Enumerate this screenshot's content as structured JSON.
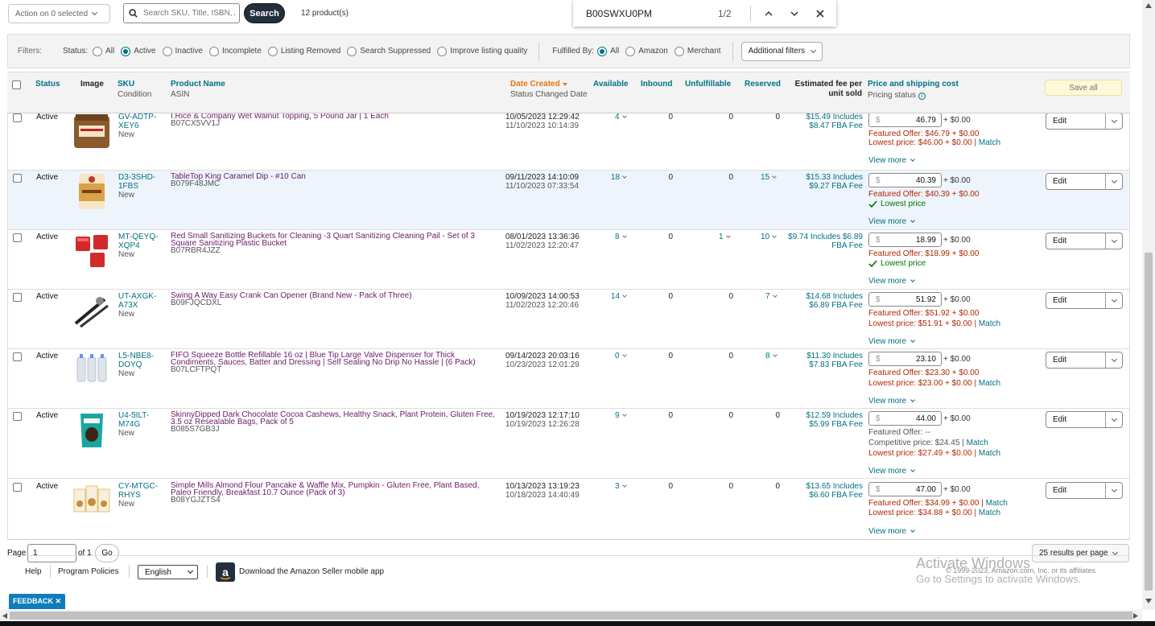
{
  "toolbar": {
    "action_label": "Action on 0 selected",
    "search_placeholder": "Search SKU, Title, ISBN, ASIN",
    "search_button": "Search",
    "product_count": "12 product(s)"
  },
  "findbar": {
    "query": "B00SWXU0PM",
    "count": "1/2"
  },
  "filters": {
    "label": "Filters:",
    "status_label": "Status:",
    "status_options": [
      "All",
      "Active",
      "Inactive",
      "Incomplete",
      "Listing Removed",
      "Search Suppressed",
      "Improve listing quality"
    ],
    "status_selected": "Active",
    "fulfilled_label": "Fulfilled By:",
    "fulfilled_options": [
      "All",
      "Amazon",
      "Merchant"
    ],
    "fulfilled_selected": "All",
    "additional_filters": "Additional filters"
  },
  "table": {
    "headers": {
      "status": "Status",
      "image": "Image",
      "sku": "SKU",
      "condition": "Condition",
      "product_name": "Product Name",
      "asin": "ASIN",
      "date_created": "Date Created",
      "status_changed": "Status Changed Date",
      "available": "Available",
      "inbound": "Inbound",
      "unfulfillable": "Unfulfillable",
      "reserved": "Reserved",
      "estimated_fee": "Estimated fee per unit sold",
      "price_shipping": "Price and shipping cost",
      "pricing_status": "Pricing status"
    },
    "save_all": "Save all",
    "view_more": "View more",
    "edit_label": "Edit",
    "currency_symbol": "$",
    "rows": [
      {
        "status": "Active",
        "sku": "GV-ADTP-XEY6",
        "condition": "New",
        "name": "I.Rice & Company Wet Walnut Topping, 5 Pound Jar | 1 Each",
        "asin": "B07CX5VV1J",
        "created": "10/05/2023 12:29:42",
        "changed": "11/10/2023 10:14:39",
        "available": "4",
        "inbound": "0",
        "unfulfillable": "0",
        "reserved": "0",
        "fee": "$15.49 Includes $8.47 FBA Fee",
        "price": "46.79",
        "ship": "+ $0.00",
        "line1": "Featured Offer: $46.79 + $0.00",
        "line2": "Lowest price: $46.00 + $0.00 | ",
        "line2_match": "Match",
        "thumb_color": "#8a5a2b",
        "highlight": false
      },
      {
        "status": "Active",
        "sku": "D3-3SHD-1FBS",
        "condition": "New",
        "name": "TableTop King Caramel Dip - #10 Can",
        "asin": "B079F48JMC",
        "created": "09/11/2023 14:10:09",
        "changed": "11/10/2023 07:33:54",
        "available": "18",
        "inbound": "0",
        "unfulfillable": "0",
        "reserved": "15",
        "fee": "$15.33 Includes $9.27 FBA Fee",
        "price": "40.39",
        "ship": "+ $0.00",
        "line1": "Featured Offer: $40.39 + $0.00",
        "line2": "Lowest price",
        "line2_match": "",
        "thumb_color": "#d9a24a",
        "highlight": true
      },
      {
        "status": "Active",
        "sku": "MT-QEYQ-XQP4",
        "condition": "New",
        "name": "Red Small Sanitizing Buckets for Cleaning -3 Quart Sanitizing Cleaning Pail - Set of 3 Square Sanitizing Plastic Bucket",
        "asin": "B07RBR4JZZ",
        "created": "08/01/2023 13:36:36",
        "changed": "11/02/2023 12:20:47",
        "available": "8",
        "inbound": "0",
        "unfulfillable": "1",
        "reserved": "10",
        "fee": "$9.74 Includes $6.89 FBA Fee",
        "price": "18.99",
        "ship": "+ $0.00",
        "line1": "Featured Offer: $18.99 + $0.00",
        "line2": "Lowest price",
        "line2_match": "",
        "thumb_color": "#d22a2a",
        "highlight": false
      },
      {
        "status": "Active",
        "sku": "UT-AXGK-A73X",
        "condition": "New",
        "name": "Swing A Way Easy Crank Can Opener (Brand New - Pack of Three)",
        "asin": "B09FJQCDXL",
        "created": "10/09/2023 14:00:53",
        "changed": "11/02/2023 12:20:46",
        "available": "14",
        "inbound": "0",
        "unfulfillable": "0",
        "reserved": "7",
        "fee": "$14.68 Includes $6.89 FBA Fee",
        "price": "51.92",
        "ship": "+ $0.00",
        "line1": "Featured Offer: $51.92 + $0.00",
        "line2": "Lowest price: $51.91 + $0.00 | ",
        "line2_match": "Match",
        "thumb_color": "#222222",
        "highlight": false
      },
      {
        "status": "Active",
        "sku": "L5-NBE8-DOYQ",
        "condition": "New",
        "name": "FIFO Squeeze Bottle Refillable 16 oz | Blue Tip Large Valve Dispenser for Thick Condiments, Sauces, Batter and Dressing | Self Sealing No Drip No Hassle | (6 Pack)",
        "asin": "B07LCFTPQT",
        "created": "09/14/2023 20:03:16",
        "changed": "10/23/2023 12:01:29",
        "available": "0",
        "inbound": "0",
        "unfulfillable": "0",
        "reserved": "8",
        "fee": "$11.30 Includes $7.83 FBA Fee",
        "price": "23.10",
        "ship": "+ $0.00",
        "line1": "Featured Offer: $23.30 + $0.00",
        "line2": "Lowest price: $23.00 + $0.00 | ",
        "line2_match": "Match",
        "thumb_color": "#dde3ea",
        "highlight": false
      },
      {
        "status": "Active",
        "sku": "U4-5ILT-M74G",
        "condition": "New",
        "name": "SkinnyDipped Dark Chocolate Cocoa Cashews, Healthy Snack, Plant Protein, Gluten Free, 3.5 oz Resealable Bags, Pack of 5",
        "asin": "B085S7GB3J",
        "created": "10/19/2023 12:17:10",
        "changed": "10/19/2023 12:26:28",
        "available": "9",
        "inbound": "0",
        "unfulfillable": "0",
        "reserved": "0",
        "fee": "$12.59 Includes $5.99 FBA Fee",
        "price": "44.00",
        "ship": "+ $0.00",
        "line1": "Featured Offer: --",
        "line1b": "Competitive price: $24.45 | ",
        "line1b_match": "Match",
        "line2": "Lowest price: $27.49 + $0.00 | ",
        "line2_match": "Match",
        "thumb_color": "#1aa6a0",
        "highlight": false
      },
      {
        "status": "Active",
        "sku": "CY-MTGC-RHYS",
        "condition": "New",
        "name": "Simple Mills Almond Flour Pancake & Waffle Mix, Pumpkin - Gluten Free, Plant Based, Paleo Friendly, Breakfast 10.7 Ounce (Pack of 3)",
        "asin": "B08YGJZTS4",
        "created": "10/13/2023 13:19:23",
        "changed": "10/18/2023 14:40:49",
        "available": "3",
        "inbound": "0",
        "unfulfillable": "0",
        "reserved": "0",
        "fee": "$13.65 Includes $6.60 FBA Fee",
        "price": "47.00",
        "ship": "+ $0.00",
        "line1": "Featured Offer: $34.99 + $0.00 | ",
        "line1_match": "Match",
        "line2": "Lowest price: $34.88 + $0.00 | ",
        "line2_match": "Match",
        "thumb_color": "#e7c06a",
        "highlight": false
      }
    ]
  },
  "pagination": {
    "page_label": "Page",
    "page_value": "1",
    "of_label": "of 1",
    "go_label": "Go",
    "per_page": "25 results per page"
  },
  "footer": {
    "help": "Help",
    "policies": "Program Policies",
    "language": "English",
    "download": "Download the Amazon Seller mobile app",
    "copyright": "© 1999-2023, Amazon.com, Inc. or its affiliates"
  },
  "watermark": {
    "title": "Activate Windows",
    "sub": "Go to Settings to activate Windows."
  },
  "feedback": "FEEDBACK ✕",
  "colors": {
    "teal": "#007185",
    "purple": "#6a1b6a",
    "orange": "#e47911",
    "navy": "#232f3e"
  }
}
